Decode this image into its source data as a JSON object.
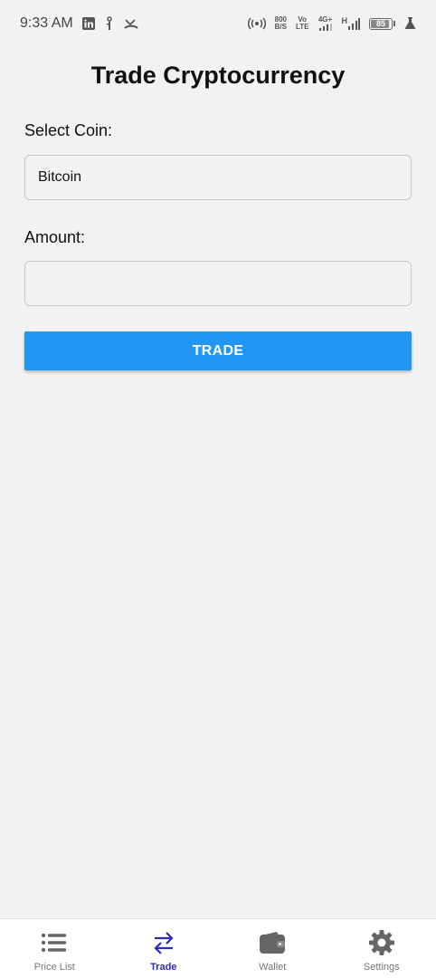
{
  "status_bar": {
    "time": "9:33 AM",
    "data_speed_value": "800",
    "data_speed_unit": "B/S",
    "volte_top": "Vo",
    "volte_bottom": "LTE",
    "network_type": "4G+",
    "network_h": "H",
    "battery": "85"
  },
  "page": {
    "title": "Trade Cryptocurrency"
  },
  "form": {
    "coin_label": "Select Coin:",
    "coin_value": "Bitcoin",
    "amount_label": "Amount:",
    "amount_value": "",
    "trade_button": "TRADE"
  },
  "bottom_nav": {
    "items": [
      {
        "label": "Price List",
        "icon": "list-icon"
      },
      {
        "label": "Trade",
        "icon": "swap-arrows-icon"
      },
      {
        "label": "Wallet",
        "icon": "wallet-icon"
      },
      {
        "label": "Settings",
        "icon": "gear-icon"
      }
    ],
    "active_index": 1
  },
  "colors": {
    "accent": "#2196f3",
    "nav_active": "#2b2bbf",
    "background": "#f2f2f2"
  }
}
